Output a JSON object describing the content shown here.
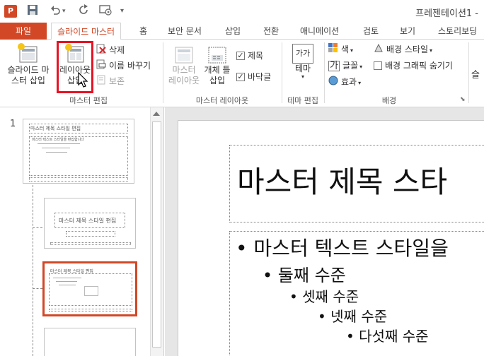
{
  "app_icon_label": "P",
  "window_title": "프레젠테이션1 -",
  "quick_access": [
    "save-icon",
    "undo-icon",
    "redo-icon",
    "present-icon",
    "customize-icon"
  ],
  "tabs": {
    "file": "파일",
    "items": [
      "슬라이드 마스터",
      "홈",
      "보안 문서",
      "삽입",
      "전환",
      "애니메이션",
      "검토",
      "보기",
      "스토리보딩"
    ]
  },
  "ribbon": {
    "master_edit": {
      "label": "마스터 편집",
      "insert_slide_master": "슬라이드 마\n스터 삽입",
      "insert_layout": "레이아웃\n삽입",
      "delete": "삭제",
      "rename": "이름 바꾸기",
      "preserve": "보존"
    },
    "master_layout": {
      "label": "마스터 레이아웃",
      "master_layout_btn": "마스터\n레이아웃",
      "insert_placeholder": "개체 틀\n삽입",
      "title_check": "제목",
      "footer_check": "바닥글"
    },
    "theme_edit": {
      "label": "테마 편집",
      "themes": "테마",
      "theme_icon_text": "가가"
    },
    "background": {
      "label": "배경",
      "colors": "색",
      "fonts": "글꼴",
      "effects": "효과",
      "background_styles": "배경 스타일",
      "hide_background_graphics": "배경 그래픽 숨기기"
    },
    "cut_off": "슬"
  },
  "thumbnails": {
    "slide_number": "1",
    "master_title": "마스터 제목 스타일 편집",
    "master_body": "마스터 텍스트 스타일을 편집합니다",
    "layout1_title": "마스터 제목 스타일 편집",
    "layout2_title": "마스터 제목 스타일 편집"
  },
  "slide": {
    "title": "마스터 제목 스타",
    "bullets": [
      {
        "level": 1,
        "text": "마스터 텍스트 스타일을"
      },
      {
        "level": 2,
        "text": "둘째 수준"
      },
      {
        "level": 3,
        "text": "셋째 수준"
      },
      {
        "level": 4,
        "text": "넷째 수준"
      },
      {
        "level": 5,
        "text": "다섯째 수준"
      }
    ]
  },
  "colors": {
    "accent": "#d24726",
    "highlight_border": "#e81123"
  }
}
